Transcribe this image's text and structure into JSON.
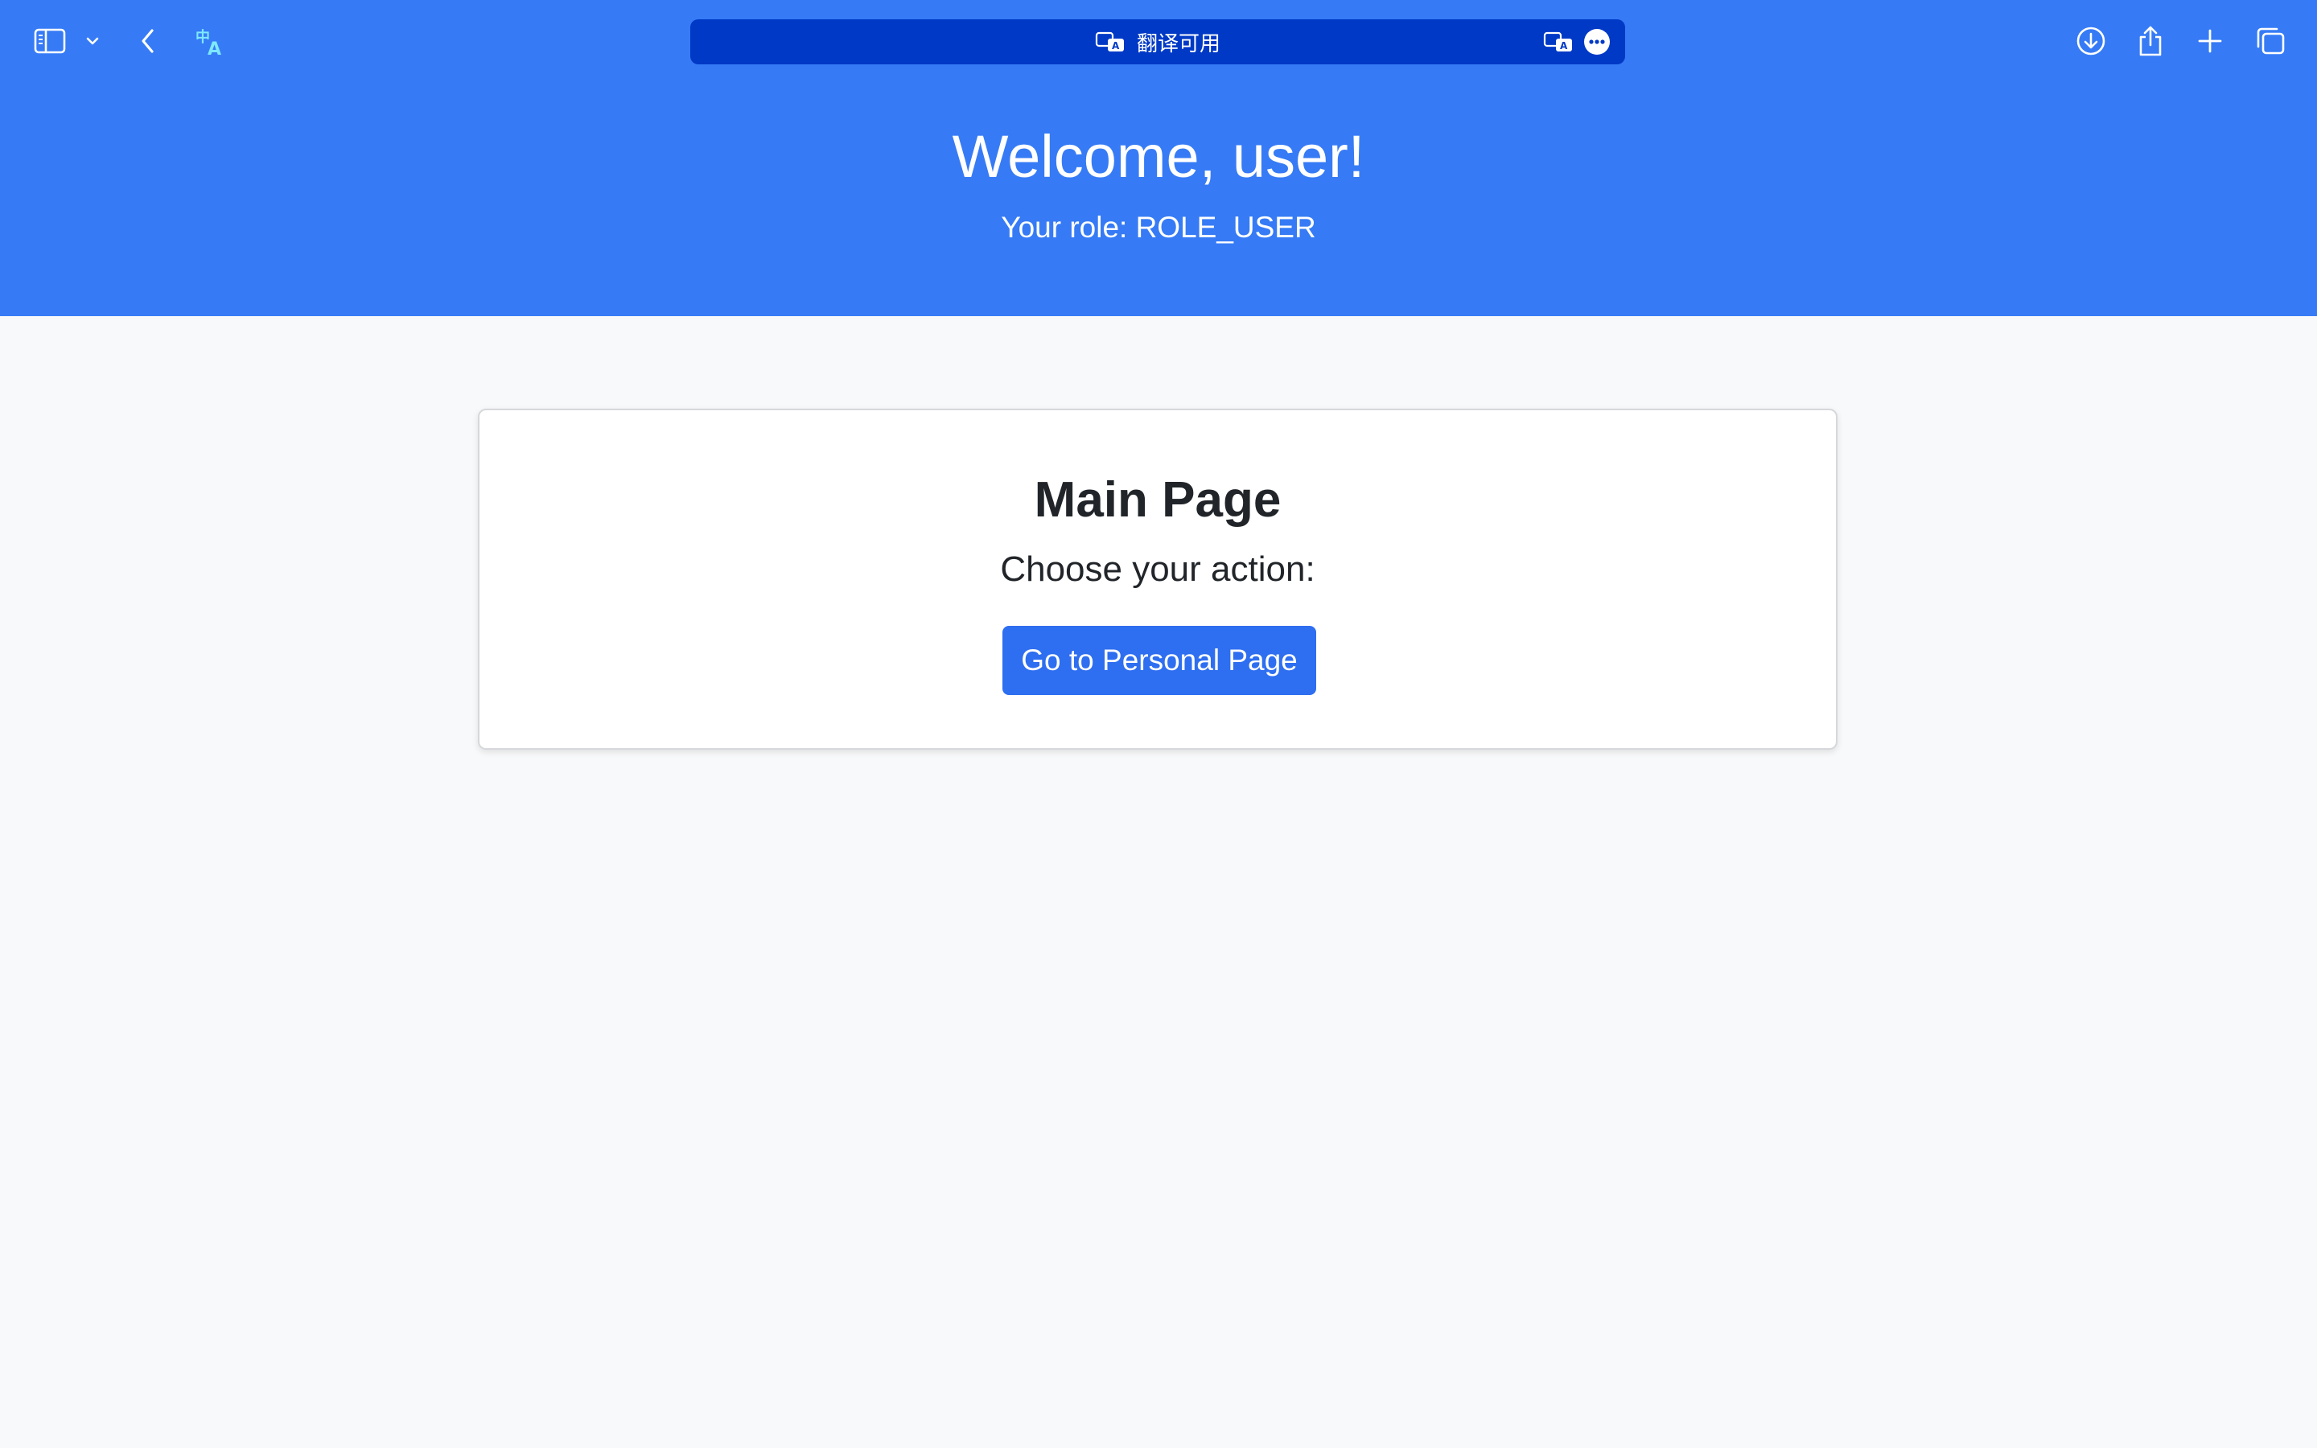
{
  "browser": {
    "address_bar": {
      "text": "翻译可用"
    },
    "icons": {
      "sidebar": "sidebar-icon",
      "sidebar_menu": "chevron-down-icon",
      "back": "chevron-left-icon",
      "translate": "translate-icon",
      "download": "download-icon",
      "share": "share-icon",
      "new_tab": "plus-icon",
      "tabs": "tab-overview-icon",
      "more": "more-icon"
    }
  },
  "header": {
    "title": "Welcome, user!",
    "role_text": "Your role: ROLE_USER",
    "background": "#367bf5"
  },
  "card": {
    "title": "Main Page",
    "subtitle": "Choose your action:",
    "button_label": "Go to Personal Page",
    "button_color": "#2e6ef0"
  }
}
